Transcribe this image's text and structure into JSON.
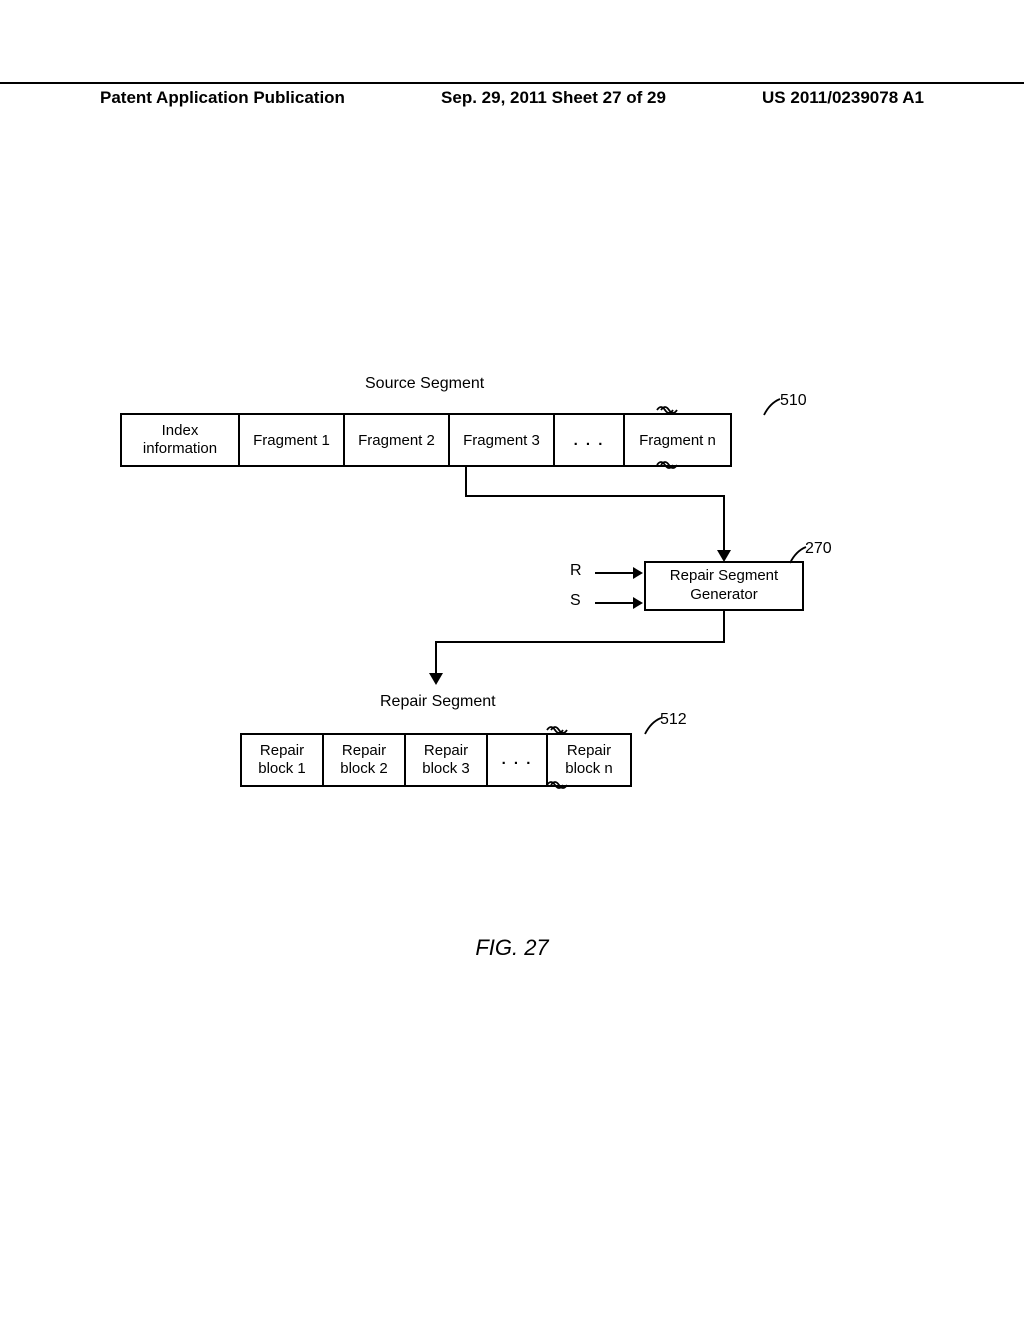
{
  "header": {
    "left": "Patent Application Publication",
    "date": "Sep. 29, 2011  Sheet 27 of 29",
    "right": "US 2011/0239078 A1"
  },
  "source_segment": {
    "label": "Source Segment",
    "ref": "510",
    "cells": {
      "index": "Index\ninformation",
      "f1": "Fragment 1",
      "f2": "Fragment 2",
      "f3": "Fragment 3",
      "dots": ". . .",
      "fn": "Fragment n"
    }
  },
  "inputs": {
    "R": "R",
    "S": "S"
  },
  "generator": {
    "label": "Repair Segment\nGenerator",
    "ref": "270"
  },
  "repair_segment": {
    "label": "Repair Segment",
    "ref": "512",
    "cells": {
      "b1": "Repair\nblock 1",
      "b2": "Repair\nblock 2",
      "b3": "Repair\nblock 3",
      "dots": ". . .",
      "bn": "Repair\nblock n"
    }
  },
  "figure_caption": "FIG. 27",
  "chart_data": {
    "type": "table",
    "title": "FIG. 27",
    "description": "Source Segment containing Index information and Fragments 1..n is input to a Repair Segment Generator (ref 270) along with parameters R and S, producing a Repair Segment (ref 512) of Repair blocks 1..n.",
    "source_segment_ref": 510,
    "generator_ref": 270,
    "repair_segment_ref": 512,
    "inputs": [
      "R",
      "S"
    ],
    "source_segment_columns": [
      "Index information",
      "Fragment 1",
      "Fragment 2",
      "Fragment 3",
      "...",
      "Fragment n"
    ],
    "repair_segment_columns": [
      "Repair block 1",
      "Repair block 2",
      "Repair block 3",
      "...",
      "Repair block n"
    ]
  }
}
